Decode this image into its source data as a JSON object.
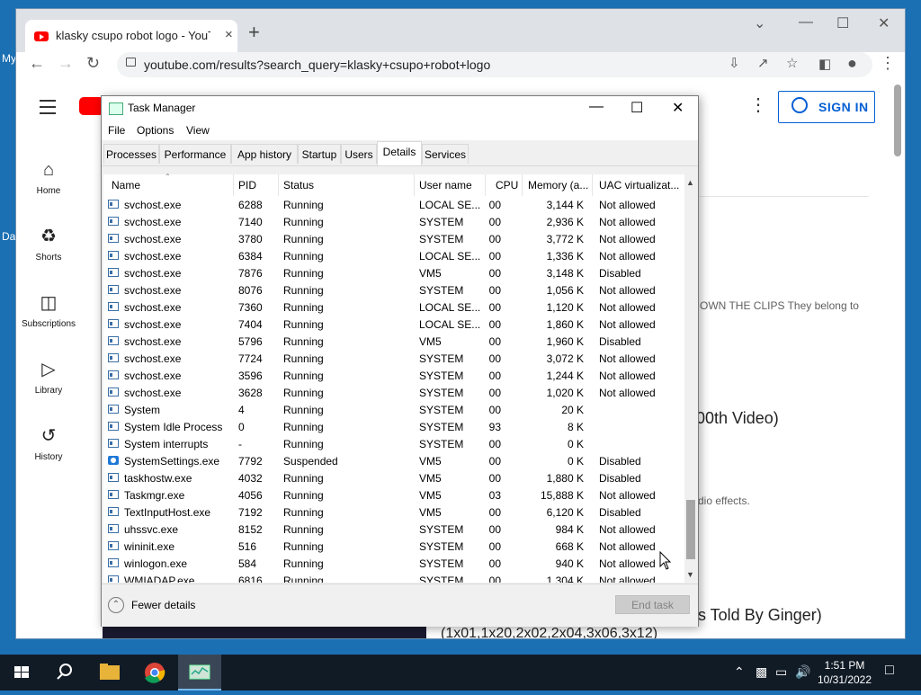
{
  "desktop": {
    "label_top": "My",
    "label_mid": "Da"
  },
  "browser": {
    "tab_title": "klasky csupo robot logo - YouTube",
    "tab_close": "×",
    "new_tab": "+",
    "url": "youtube.com/results?search_query=klasky+csupo+robot+logo",
    "window_controls": {
      "minimize": "—",
      "maximize": "☐",
      "close": "✕",
      "dropdown": "⌄"
    }
  },
  "youtube": {
    "nav": [
      {
        "label": "Home",
        "icon": "home-icon"
      },
      {
        "label": "Shorts",
        "icon": "shorts-icon"
      },
      {
        "label": "Subscriptions",
        "icon": "subscriptions-icon"
      },
      {
        "label": "Library",
        "icon": "library-icon"
      },
      {
        "label": "History",
        "icon": "history-icon"
      }
    ],
    "sign_in": "SIGN IN",
    "bg_snippets": [
      "OWN THE CLIPS They belong to",
      "00th Video)",
      "dio effects.",
      "s Told By Ginger)",
      "(1x01,1x20,2x02,2x04,3x06,3x12)"
    ]
  },
  "task_manager": {
    "title": "Task Manager",
    "controls": {
      "minimize": "—",
      "maximize": "☐",
      "close": "✕"
    },
    "menu": [
      "File",
      "Options",
      "View"
    ],
    "tabs": [
      "Processes",
      "Performance",
      "App history",
      "Startup",
      "Users",
      "Details",
      "Services"
    ],
    "active_tab": "Details",
    "columns": [
      "Name",
      "PID",
      "Status",
      "User name",
      "CPU",
      "Memory (a...",
      "UAC virtualizat..."
    ],
    "rows": [
      [
        "svchost.exe",
        "6288",
        "Running",
        "LOCAL SE...",
        "00",
        "3,144 K",
        "Not allowed"
      ],
      [
        "svchost.exe",
        "7140",
        "Running",
        "SYSTEM",
        "00",
        "2,936 K",
        "Not allowed"
      ],
      [
        "svchost.exe",
        "3780",
        "Running",
        "SYSTEM",
        "00",
        "3,772 K",
        "Not allowed"
      ],
      [
        "svchost.exe",
        "6384",
        "Running",
        "LOCAL SE...",
        "00",
        "1,336 K",
        "Not allowed"
      ],
      [
        "svchost.exe",
        "7876",
        "Running",
        "VM5",
        "00",
        "3,148 K",
        "Disabled"
      ],
      [
        "svchost.exe",
        "8076",
        "Running",
        "SYSTEM",
        "00",
        "1,056 K",
        "Not allowed"
      ],
      [
        "svchost.exe",
        "7360",
        "Running",
        "LOCAL SE...",
        "00",
        "1,120 K",
        "Not allowed"
      ],
      [
        "svchost.exe",
        "7404",
        "Running",
        "LOCAL SE...",
        "00",
        "1,860 K",
        "Not allowed"
      ],
      [
        "svchost.exe",
        "5796",
        "Running",
        "VM5",
        "00",
        "1,960 K",
        "Disabled"
      ],
      [
        "svchost.exe",
        "7724",
        "Running",
        "SYSTEM",
        "00",
        "3,072 K",
        "Not allowed"
      ],
      [
        "svchost.exe",
        "3596",
        "Running",
        "SYSTEM",
        "00",
        "1,244 K",
        "Not allowed"
      ],
      [
        "svchost.exe",
        "3628",
        "Running",
        "SYSTEM",
        "00",
        "1,020 K",
        "Not allowed"
      ],
      [
        "System",
        "4",
        "Running",
        "SYSTEM",
        "00",
        "20 K",
        ""
      ],
      [
        "System Idle Process",
        "0",
        "Running",
        "SYSTEM",
        "93",
        "8 K",
        ""
      ],
      [
        "System interrupts",
        "-",
        "Running",
        "SYSTEM",
        "00",
        "0 K",
        ""
      ],
      [
        "SystemSettings.exe",
        "7792",
        "Suspended",
        "VM5",
        "00",
        "0 K",
        "Disabled"
      ],
      [
        "taskhostw.exe",
        "4032",
        "Running",
        "VM5",
        "00",
        "1,880 K",
        "Disabled"
      ],
      [
        "Taskmgr.exe",
        "4056",
        "Running",
        "VM5",
        "03",
        "15,888 K",
        "Not allowed"
      ],
      [
        "TextInputHost.exe",
        "7192",
        "Running",
        "VM5",
        "00",
        "6,120 K",
        "Disabled"
      ],
      [
        "uhssvc.exe",
        "8152",
        "Running",
        "SYSTEM",
        "00",
        "984 K",
        "Not allowed"
      ],
      [
        "wininit.exe",
        "516",
        "Running",
        "SYSTEM",
        "00",
        "668 K",
        "Not allowed"
      ],
      [
        "winlogon.exe",
        "584",
        "Running",
        "SYSTEM",
        "00",
        "940 K",
        "Not allowed"
      ],
      [
        "WMIADAP.exe",
        "6816",
        "Running",
        "SYSTEM",
        "00",
        "1,304 K",
        "Not allowed"
      ]
    ],
    "fewer_details": "Fewer details",
    "end_task": "End task"
  },
  "taskbar": {
    "time": "1:51 PM",
    "date": "10/31/2022"
  }
}
